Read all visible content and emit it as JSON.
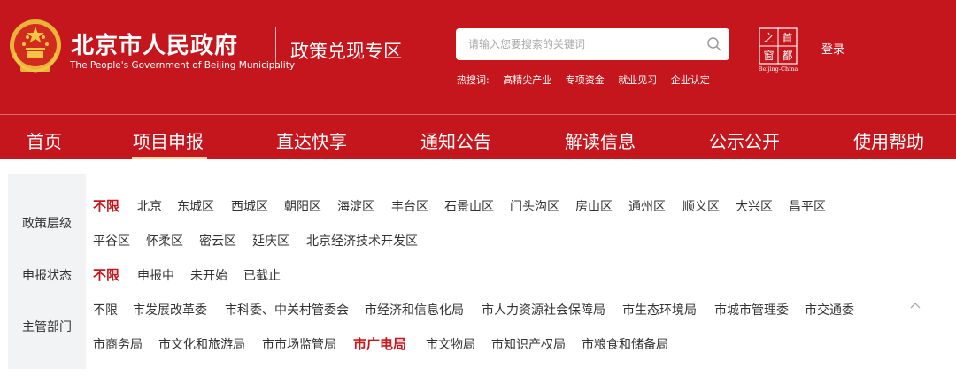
{
  "header": {
    "site_name": "北京市人民政府",
    "site_name_en": "The People's Government of Beijing Municipality",
    "zone_name": "政策兑现专区",
    "search_placeholder": "请输入您要搜索的关键词",
    "hot_label": "热搜词:",
    "hot_terms": [
      "高精尖产业",
      "专项资金",
      "就业见习",
      "企业认定"
    ],
    "capital_logo_text": "Beijing-China",
    "login": "登录",
    "brand_color": "#c5161d"
  },
  "nav": {
    "items": [
      "首页",
      "项目申报",
      "直达快享",
      "通知公告",
      "解读信息",
      "公示公开",
      "使用帮助"
    ],
    "active": "项目申报"
  },
  "filters": {
    "policy_level": {
      "label": "政策层级",
      "options": [
        "不限",
        "北京",
        "东城区",
        "西城区",
        "朝阳区",
        "海淀区",
        "丰台区",
        "石景山区",
        "门头沟区",
        "房山区",
        "通州区",
        "顺义区",
        "大兴区",
        "昌平区",
        "平谷区",
        "怀柔区",
        "密云区",
        "延庆区",
        "北京经济技术开发区"
      ],
      "selected": "不限"
    },
    "status": {
      "label": "申报状态",
      "options": [
        "不限",
        "申报中",
        "未开始",
        "已截止"
      ],
      "selected": "不限"
    },
    "department": {
      "label": "主管部门",
      "options": [
        "不限",
        "市发展改革委",
        "市科委、中关村管委会",
        "市经济和信息化局",
        "市人力资源社会保障局",
        "市生态环境局",
        "市城市管理委",
        "市交通委",
        "市商务局",
        "市文化和旅游局",
        "市市场监管局",
        "市广电局",
        "市文物局",
        "市知识产权局",
        "市粮食和储备局"
      ],
      "selected": "市广电局"
    }
  }
}
